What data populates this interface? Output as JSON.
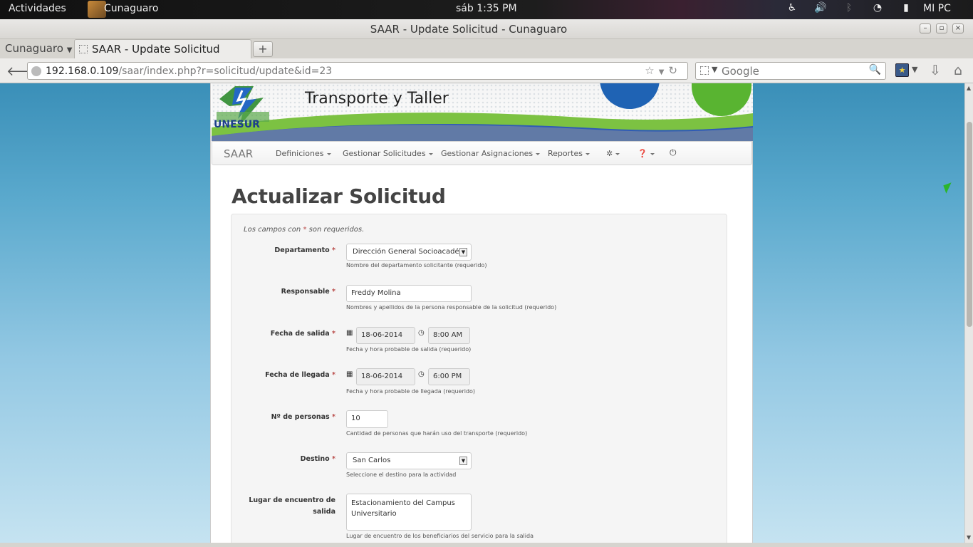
{
  "system_bar": {
    "activities": "Actividades",
    "app_name": "Cunaguaro",
    "clock": "sáb  1:35 PM",
    "user": "MI PC"
  },
  "window": {
    "title": "SAAR - Update Solicitud - Cunaguaro"
  },
  "tabs": {
    "group_label": "Cunaguaro",
    "active_tab": "SAAR - Update Solicitud",
    "new_tab": "+"
  },
  "navbar": {
    "url_host": "192.168.0.109",
    "url_path": "/saar/index.php?r=solicitud/update&id=23",
    "search_placeholder": "Google"
  },
  "banner": {
    "title": "Transporte y Taller",
    "logo_text": "UNESUR"
  },
  "menu": {
    "brand": "SAAR",
    "items": [
      {
        "label": "Definiciones"
      },
      {
        "label": "Gestionar Solicitudes"
      },
      {
        "label": "Gestionar Asignaciones"
      },
      {
        "label": "Reportes"
      }
    ]
  },
  "form": {
    "heading": "Actualizar Solicitud",
    "required_note_pre": "Los campos con ",
    "required_mark": "*",
    "required_note_post": " son requeridos.",
    "fields": {
      "departamento": {
        "label": "Departamento",
        "value": "Dirección General Socioacadé",
        "help": "Nombre del departamento solicitante (requerido)"
      },
      "responsable": {
        "label": "Responsable",
        "value": "Freddy Molina",
        "help": "Nombres y apellidos de la persona responsable de la solicitud (requerido)"
      },
      "fecha_salida": {
        "label": "Fecha de salida",
        "date": "18-06-2014",
        "time": "8:00 AM",
        "help": "Fecha y hora probable de salida (requerido)"
      },
      "fecha_llegada": {
        "label": "Fecha de llegada",
        "date": "18-06-2014",
        "time": "6:00 PM",
        "help": "Fecha y hora probable de llegada (requerido)"
      },
      "personas": {
        "label": "Nº de personas",
        "value": "10",
        "help": "Cantidad de personas que harán uso del transporte (requerido)"
      },
      "destino": {
        "label": "Destino",
        "value": "San Carlos",
        "help": "Seleccione el destino para la actividad"
      },
      "lugar": {
        "label": "Lugar de encuentro de salida",
        "value": "Estacionamiento del Campus Universitario",
        "help": "Lugar de encuentro de los beneficiarios del servicio para la salida"
      }
    }
  },
  "colors": {
    "required": "#b94a48",
    "banner_blue": "#1f63b4",
    "banner_green": "#59b431"
  }
}
